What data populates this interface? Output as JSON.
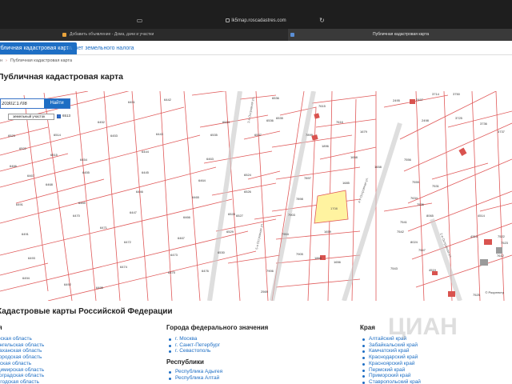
{
  "browser": {
    "url": "lk5map.roscadastres.com",
    "tabs": [
      {
        "label": "Добавить объявление - Дома, дачи и участки",
        "active": false
      },
      {
        "label": "Публичная кадастровая карта",
        "active": true
      }
    ]
  },
  "site_tabs": [
    {
      "label": "Публичная кадастровая карта",
      "active": true
    },
    {
      "label": "Расчет земельного налога",
      "active": false
    }
  ],
  "breadcrumbs": [
    "",
    "Публичная кадастровая карта"
  ],
  "page_title": "Публичная кадастровая карта",
  "search": {
    "value": "20302:1708",
    "button": "Найти"
  },
  "layer": {
    "prefix": "",
    "select_label": "земельный участок",
    "count": "6513"
  },
  "map": {
    "highlighted_parcel": "1708",
    "streets": [
      "3-я Островная ул.",
      "4-я Островная ул.",
      "5-я Островная ул.",
      "2-я Островная ул."
    ],
    "parcel_labels": [
      "6451",
      "6442",
      "6534",
      "6536",
      "6523",
      "6514",
      "6452",
      "6453",
      "6443",
      "6535",
      "6537",
      "6522",
      "6515",
      "6454",
      "6444",
      "6463",
      "6524",
      "6466",
      "6467",
      "6468",
      "6455",
      "6445",
      "6464",
      "6526",
      "6469",
      "6446",
      "6465",
      "6527",
      "6491",
      "6470",
      "6471",
      "6447",
      "6466",
      "6528",
      "6491",
      "6472",
      "6467",
      "6529",
      "6493",
      "6473",
      "6530",
      "6494",
      "6475",
      "6474",
      "6476",
      "6492",
      "6495",
      "2569",
      "6536",
      "6535",
      "7615",
      "7616",
      "1679",
      "7899",
      "1896",
      "1658",
      "7897",
      "1685",
      "7898",
      "7903",
      "1659",
      "7904",
      "7905",
      "1656",
      "7906",
      "1869",
      "2495",
      "2497",
      "2498",
      "3714",
      "3750",
      "3725",
      "3736",
      "3737",
      "7556",
      "7555",
      "7531",
      "7634",
      "7536",
      "8065",
      "7541",
      "7542",
      "4514",
      "4313",
      "7547",
      "7543",
      "8024",
      "4519",
      "7525",
      "7522",
      "7523",
      "7612",
      "1658",
      "1708"
    ],
    "scale": "© Росреестр"
  },
  "bottom": {
    "title": "Кадастровые карты Российской Федерации",
    "regions_column": [
      "Амурская область",
      "Архангельская область",
      "Астраханская область",
      "Белгородская область",
      "Брянская область",
      "Владимирская область",
      "Волгоградская область",
      "Вологодская область"
    ],
    "federal_cities_title": "Города федерального значения",
    "federal_cities": [
      "г. Москва",
      "г. Санкт-Петербург",
      "г. Севастополь"
    ],
    "republics_title": "Республики",
    "republics": [
      "Республика Адыгея",
      "Республика Алтай"
    ],
    "krai_title": "Края",
    "krai": [
      "Алтайский край",
      "Забайкальский край",
      "Камчатский край",
      "Краснодарский край",
      "Красноярский край",
      "Пермский край",
      "Приморский край",
      "Ставропольский край"
    ]
  },
  "watermark": "ЦИАН",
  "colors": {
    "accent": "#1d6ec4",
    "parcel_line": "#e05a5a",
    "highlight": "#fff3a0"
  }
}
